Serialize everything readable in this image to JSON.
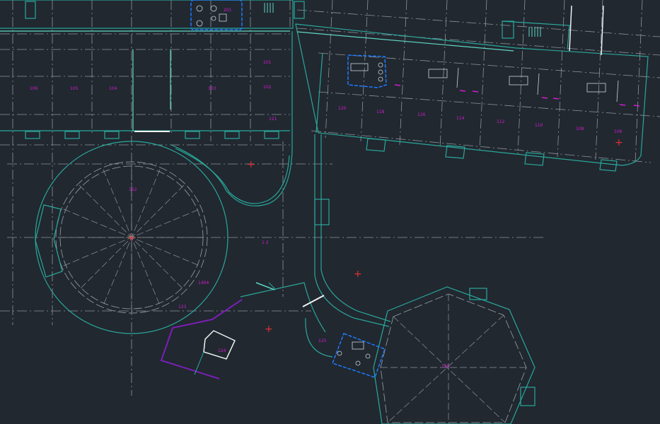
{
  "app": {
    "name": "CAD floor plan viewport"
  },
  "colors": {
    "background": "#212830",
    "gridline": "#9aa0a6",
    "wall": "#2aa79b",
    "wall_highlight": "#5fd4c2",
    "room_label": "#d21ccc",
    "selected_block": "#1e7bff",
    "accent_purple": "#7a1fb5",
    "marker_red": "#e03131",
    "fixture": "#c8d2dc",
    "white": "#f0f0f0"
  },
  "room_labels": {
    "left_row": [
      "106",
      "105",
      "104",
      "103",
      "102",
      "101"
    ],
    "right_row": [
      "120",
      "118",
      "116",
      "114",
      "112",
      "110",
      "108",
      "106"
    ],
    "center": "121",
    "corridor": "1 2",
    "rotunda": "122",
    "rotunda_lower": "1404",
    "small_room": "123",
    "diag_room": "124",
    "lower_block": "125",
    "hex_room": "126",
    "top_block": "201"
  },
  "markers": {
    "cross_symbol": "+"
  }
}
